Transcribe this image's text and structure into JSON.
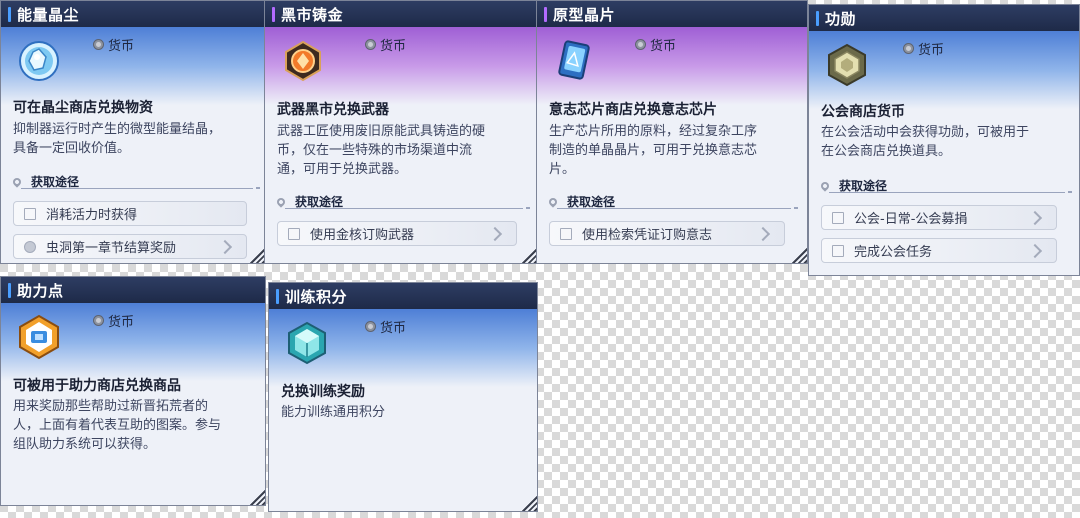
{
  "cards": [
    {
      "title": "能量晶尘",
      "badge": "货币",
      "subtitle": "可在晶尘商店兑换物资",
      "desc": [
        "抑制器运行时产生的微型能量结晶，",
        "具备一定回收价值。"
      ],
      "source_title": "获取途径",
      "sources": [
        "消耗活力时获得",
        "虫洞第一章节结算奖励"
      ],
      "icon": "energy-crystal-dust-icon"
    },
    {
      "title": "黑市铸金",
      "badge": "货币",
      "subtitle": "武器黑市兑换武器",
      "desc": [
        "武器工匠使用废旧原能武具铸造的硬",
        "币，仅在一些特殊的市场渠道中流",
        "通，可用于兑换武器。"
      ],
      "source_title": "获取途径",
      "sources": [
        "使用金核订购武器"
      ],
      "icon": "black-market-coin-icon"
    },
    {
      "title": "原型晶片",
      "badge": "货币",
      "subtitle": "意志芯片商店兑换意志芯片",
      "desc": [
        "生产芯片所用的原料，经过复杂工序",
        "制造的单晶晶片，可用于兑换意志芯",
        "片。"
      ],
      "source_title": "获取途径",
      "sources": [
        "使用检索凭证订购意志"
      ],
      "icon": "prototype-chip-icon"
    },
    {
      "title": "功勋",
      "badge": "货币",
      "subtitle": "公会商店货币",
      "desc": [
        "在公会活动中会获得功勋，可被用于",
        "在公会商店兑换道具。"
      ],
      "source_title": "获取途径",
      "sources": [
        "公会-日常-公会募捐",
        "完成公会任务"
      ],
      "icon": "merit-icon"
    },
    {
      "title": "助力点",
      "badge": "货币",
      "subtitle": "可被用于助力商店兑换商品",
      "desc": [
        "用来奖励那些帮助过新晋拓荒者的",
        "人，上面有着代表互助的图案。参与",
        "组队助力系统可以获得。"
      ],
      "icon": "assist-point-icon"
    },
    {
      "title": "训练积分",
      "badge": "货币",
      "subtitle": "兑换训练奖励",
      "desc": [
        "能力训练通用积分"
      ],
      "icon": "training-points-icon"
    }
  ],
  "colors": {
    "header": "#1e2a48",
    "accent_blue": "#4a9eff",
    "accent_purple": "#b36bff"
  }
}
